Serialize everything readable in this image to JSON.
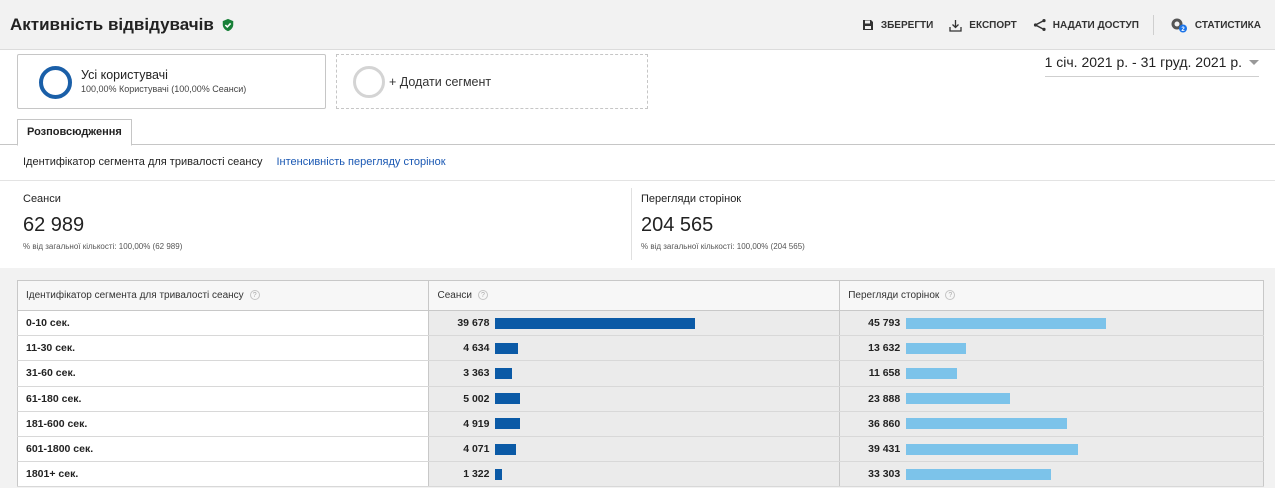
{
  "header": {
    "title": "Активність відвідувачів",
    "toolbar": {
      "save": "ЗБЕРЕГТИ",
      "export": "ЕКСПОРТ",
      "share": "НАДАТИ ДОСТУП",
      "insights": "СТАТИСТИКА"
    }
  },
  "segments": {
    "active": {
      "name": "Усі користувачі",
      "detail": "100,00% Користувачі (100,00% Сеанси)"
    },
    "add_label": "+ Додати сегмент"
  },
  "date_range": "1 січ. 2021 р. - 31 груд. 2021 р.",
  "tabs": [
    "Розповсюдження"
  ],
  "dimensions": {
    "active": "Ідентифікатор сегмента для тривалості сеансу",
    "link": "Інтенсивність перегляду сторінок"
  },
  "metrics": [
    {
      "label": "Сеанси",
      "value": "62 989",
      "note": "% від загальної кількості: 100,00% (62 989)"
    },
    {
      "label": "Перегляди сторінок",
      "value": "204 565",
      "note": "% від загальної кількості: 100,00% (204 565)"
    }
  ],
  "table": {
    "headers": [
      "Ідентифікатор сегмента для тривалості сеансу",
      "Сеанси",
      "Перегляди сторінок"
    ],
    "help_glyph": "?",
    "rows": [
      {
        "segment": "0-10 сек.",
        "sessions": "39 678",
        "pageviews": "45 793"
      },
      {
        "segment": "11-30 сек.",
        "sessions": "4 634",
        "pageviews": "13 632"
      },
      {
        "segment": "31-60 сек.",
        "sessions": "3 363",
        "pageviews": "11 658"
      },
      {
        "segment": "61-180 сек.",
        "sessions": "5 002",
        "pageviews": "23 888"
      },
      {
        "segment": "181-600 сек.",
        "sessions": "4 919",
        "pageviews": "36 860"
      },
      {
        "segment": "601-1800 сек.",
        "sessions": "4 071",
        "pageviews": "39 431"
      },
      {
        "segment": "1801+ сек.",
        "sessions": "1 322",
        "pageviews": "33 303"
      }
    ]
  },
  "colors": {
    "sessions_bar": "#0b5aa6",
    "pageviews_bar": "#7cc3ea",
    "segment_ring": "#1a5fa8",
    "shield": "#188038",
    "link": "#1a58b3"
  },
  "icons": {
    "verified": "shield-check-icon",
    "save": "floppy-disk-icon",
    "export": "download-icon",
    "share": "share-icon",
    "insights": "insights-icon",
    "date_dropdown": "caret-down-icon"
  }
}
